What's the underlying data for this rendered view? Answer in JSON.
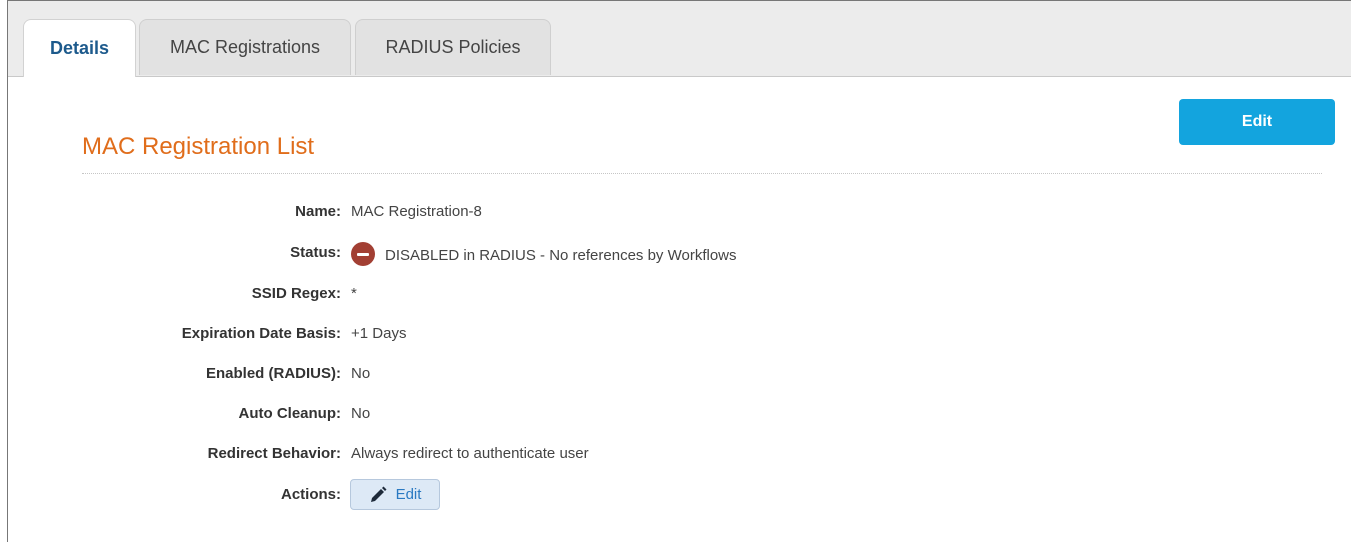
{
  "tabs": [
    {
      "label": "Details",
      "active": true
    },
    {
      "label": "MAC Registrations",
      "active": false
    },
    {
      "label": "RADIUS Policies",
      "active": false
    }
  ],
  "header": {
    "edit_label": "Edit",
    "section_title": "MAC Registration List"
  },
  "details": {
    "name": {
      "label": "Name:",
      "value": "MAC Registration-8"
    },
    "status": {
      "label": "Status:",
      "value": "DISABLED in RADIUS - No references by Workflows",
      "icon": "minus-circle-icon",
      "color": "#a23f33"
    },
    "ssid_regex": {
      "label": "SSID Regex:",
      "value": "*"
    },
    "expiration": {
      "label": "Expiration Date Basis:",
      "value": "+1 Days"
    },
    "enabled_radius": {
      "label": "Enabled (RADIUS):",
      "value": "No"
    },
    "auto_cleanup": {
      "label": "Auto Cleanup:",
      "value": "No"
    },
    "redirect": {
      "label": "Redirect Behavior:",
      "value": "Always redirect to authenticate user"
    },
    "actions": {
      "label": "Actions:",
      "edit_label": "Edit",
      "icon": "pencil-icon"
    }
  },
  "colors": {
    "accent": "#13a4de",
    "title": "#e06d1b",
    "tab_active_text": "#1d5a8c"
  }
}
